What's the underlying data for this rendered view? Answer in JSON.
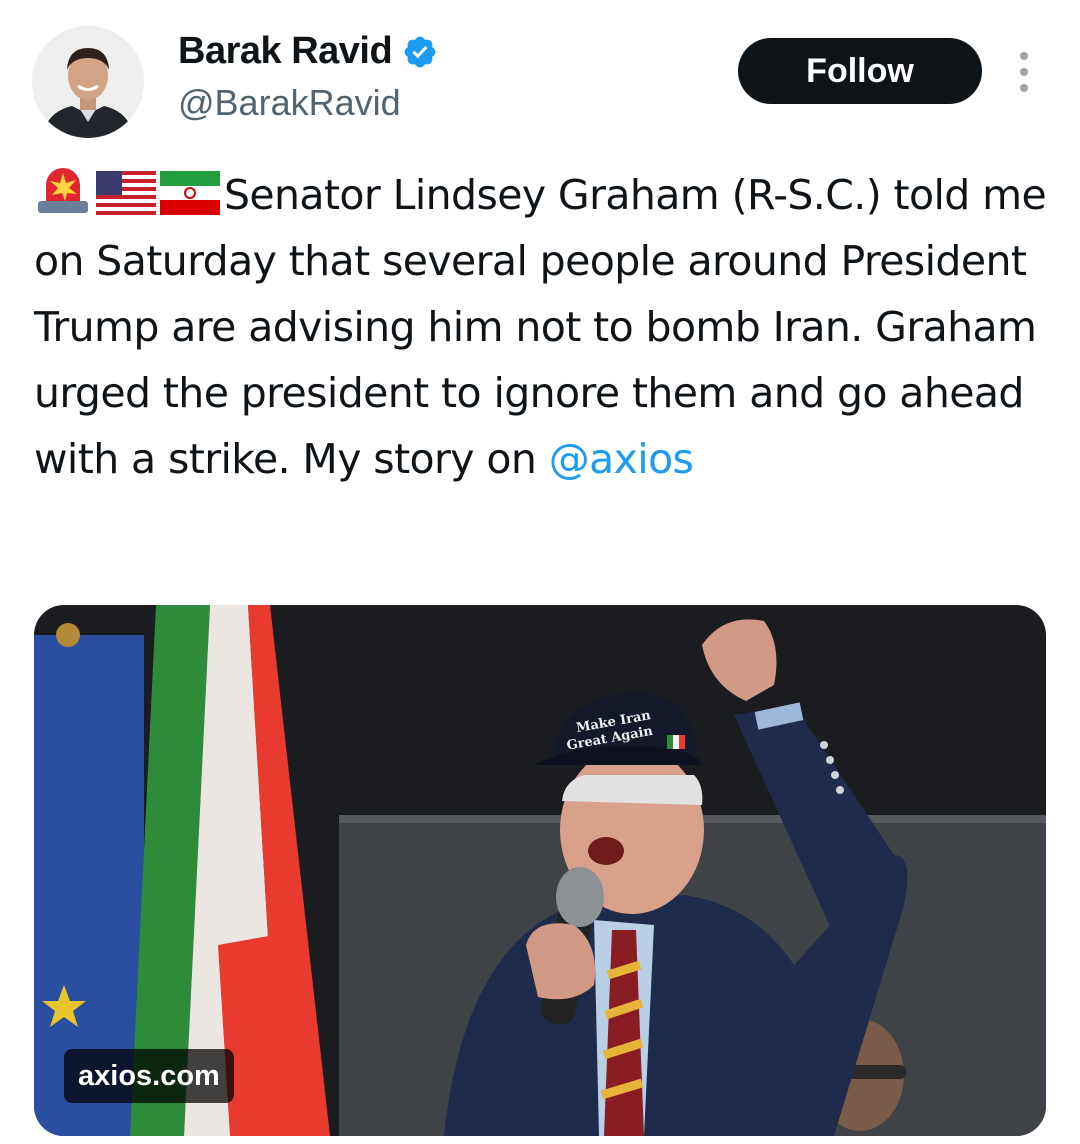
{
  "author": {
    "name": "Barak Ravid",
    "handle": "@BarakRavid",
    "verified": true,
    "avatar_icon": "avatar"
  },
  "actions": {
    "follow_label": "Follow",
    "more_icon": "more-vertical-icon"
  },
  "tweet": {
    "emojis": [
      "rotating-light-icon",
      "us-flag-icon",
      "iran-flag-icon"
    ],
    "text": "Senator Lindsey Graham (R-S.C.) told me on Saturday that several people around President Trump are advising him not to bomb Iran. Graham urged the president to ignore them and go ahead with a strike. My story on ",
    "mention": "@axios"
  },
  "media": {
    "hat_line1": "Make Iran",
    "hat_line2": "Great Again",
    "domain": "axios.com"
  },
  "colors": {
    "text": "#0f1419",
    "secondary": "#536471",
    "accent": "#1d9bf0",
    "button_bg": "#0f1419"
  }
}
